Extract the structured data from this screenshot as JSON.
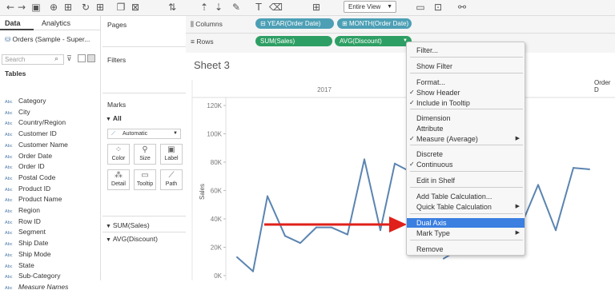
{
  "toolbar": {
    "fit_value": "Entire View",
    "icons": [
      "back-icon",
      "forward-icon",
      "save-icon",
      "add-datasource-icon",
      "new-datasource-icon",
      "undo-icon",
      "new-worksheet-icon",
      "duplicate-icon",
      "clear-sheet-icon",
      "swap-icon",
      "sort-asc-icon",
      "sort-desc-icon",
      "highlight-icon",
      "text-icon",
      "annotate-icon",
      "fix-axes-icon",
      "cards-icon",
      "presentation-icon",
      "share-icon"
    ]
  },
  "left_pane": {
    "tabs": [
      "Data",
      "Analytics"
    ],
    "datasource": "Orders (Sample - Super...",
    "search_placeholder": "Search",
    "tables_heading": "Tables",
    "fields": [
      {
        "type": "Abc",
        "label": "Category"
      },
      {
        "type": "Abc",
        "label": "City"
      },
      {
        "type": "Abc",
        "label": "Country/Region"
      },
      {
        "type": "Abc",
        "label": "Customer ID"
      },
      {
        "type": "Abc",
        "label": "Customer Name"
      },
      {
        "type": "Abc",
        "label": "Order Date"
      },
      {
        "type": "Abc",
        "label": "Order ID"
      },
      {
        "type": "Abc",
        "label": "Postal Code"
      },
      {
        "type": "Abc",
        "label": "Product ID"
      },
      {
        "type": "Abc",
        "label": "Product Name"
      },
      {
        "type": "Abc",
        "label": "Region"
      },
      {
        "type": "Abc",
        "label": "Row ID"
      },
      {
        "type": "Abc",
        "label": "Segment"
      },
      {
        "type": "Abc",
        "label": "Ship Date"
      },
      {
        "type": "Abc",
        "label": "Ship Mode"
      },
      {
        "type": "Abc",
        "label": "State"
      },
      {
        "type": "Abc",
        "label": "Sub-Category"
      },
      {
        "type": "Abc",
        "label": "Measure Names"
      }
    ]
  },
  "cards": {
    "pages": "Pages",
    "filters": "Filters",
    "marks": "Marks",
    "all": "All",
    "mark_type": "Automatic",
    "buttons": [
      "Color",
      "Size",
      "Label",
      "Detail",
      "Tooltip",
      "Path"
    ],
    "measure_cards": [
      "SUM(Sales)",
      "AVG(Discount)"
    ]
  },
  "shelves": {
    "columns_label": "Columns",
    "rows_label": "Rows",
    "columns_pills": [
      "YEAR(Order Date)",
      "MONTH(Order Date)"
    ],
    "rows_pills": [
      "SUM(Sales)",
      "AVG(Discount)"
    ]
  },
  "sheet": {
    "title": "Sheet 3",
    "column_header": "2017",
    "right_header": "Order D"
  },
  "context_menu": {
    "items": [
      {
        "label": "Filter...",
        "check": "",
        "sub": ""
      },
      {
        "label": "Show Filter",
        "check": "",
        "sub": ""
      },
      {
        "label": "Format...",
        "check": "",
        "sub": ""
      },
      {
        "label": "Show Header",
        "check": "✓",
        "sub": ""
      },
      {
        "label": "Include in Tooltip",
        "check": "✓",
        "sub": ""
      },
      {
        "label": "Dimension",
        "check": "",
        "sub": ""
      },
      {
        "label": "Attribute",
        "check": "",
        "sub": ""
      },
      {
        "label": "Measure (Average)",
        "check": "✓",
        "sub": "▶"
      },
      {
        "label": "Discrete",
        "check": "",
        "sub": ""
      },
      {
        "label": "Continuous",
        "check": "✓",
        "sub": ""
      },
      {
        "label": "Edit in Shelf",
        "check": "",
        "sub": ""
      },
      {
        "label": "Add Table Calculation...",
        "check": "",
        "sub": ""
      },
      {
        "label": "Quick Table Calculation",
        "check": "",
        "sub": "▶"
      },
      {
        "label": "Dual Axis",
        "check": "",
        "sub": ""
      },
      {
        "label": "Mark Type",
        "check": "",
        "sub": "▶"
      },
      {
        "label": "Remove",
        "check": "",
        "sub": ""
      }
    ],
    "highlight_color": "#3b7fe0"
  },
  "colors": {
    "line": "#5b84b1",
    "arrow": "#e0201a",
    "pill_blue": "#4c9fb5",
    "pill_green": "#2e9f64"
  },
  "chart_data": {
    "type": "line",
    "ylabel": "Sales",
    "ylim": [
      0,
      120000
    ],
    "yticks": [
      "0K",
      "20K",
      "40K",
      "60K",
      "80K",
      "100K",
      "120K"
    ],
    "series": [
      {
        "values": [
          13000,
          3000,
          56000,
          28000,
          23000,
          34000,
          34000,
          29000,
          82000,
          32000,
          79000,
          74000,
          null,
          null,
          null,
          null,
          null,
          12000,
          31000,
          30000,
          37000,
          64000,
          32000,
          76000,
          75000
        ]
      }
    ]
  }
}
